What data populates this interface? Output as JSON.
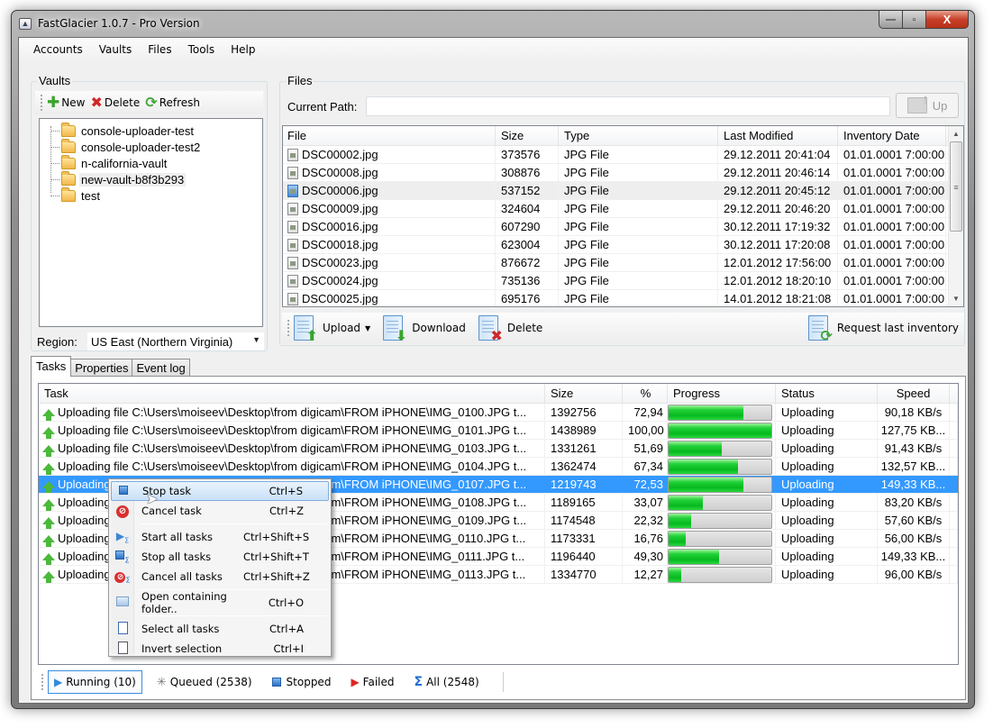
{
  "window": {
    "title": "FastGlacier 1.0.7 - Pro Version",
    "minimize_label": "—",
    "maximize_label": "▫",
    "close_label": "X"
  },
  "menu": [
    "Accounts",
    "Vaults",
    "Files",
    "Tools",
    "Help"
  ],
  "vaults": {
    "group_label": "Vaults",
    "toolbar": {
      "new": "New",
      "delete": "Delete",
      "refresh": "Refresh"
    },
    "items": [
      {
        "name": "console-uploader-test"
      },
      {
        "name": "console-uploader-test2"
      },
      {
        "name": "n-california-vault"
      },
      {
        "name": "new-vault-b8f3b293"
      },
      {
        "name": "test"
      }
    ],
    "region_label": "Region:",
    "region_value": "US East (Northern Virginia)"
  },
  "files": {
    "group_label": "Files",
    "current_path_label": "Current Path:",
    "current_path_value": "",
    "up_label": "Up",
    "columns": [
      "File",
      "Size",
      "Type",
      "Last Modified",
      "Inventory Date"
    ],
    "rows": [
      [
        "DSC00002.jpg",
        "373576",
        "JPG File",
        "29.12.2011 20:41:04",
        "01.01.0001 7:00:00"
      ],
      [
        "DSC00008.jpg",
        "308876",
        "JPG File",
        "29.12.2011 20:46:14",
        "01.01.0001 7:00:00"
      ],
      [
        "DSC00006.jpg",
        "537152",
        "JPG File",
        "29.12.2011 20:45:12",
        "01.01.0001 7:00:00"
      ],
      [
        "DSC00009.jpg",
        "324604",
        "JPG File",
        "29.12.2011 20:46:20",
        "01.01.0001 7:00:00"
      ],
      [
        "DSC00016.jpg",
        "607290",
        "JPG File",
        "30.12.2011 17:19:32",
        "01.01.0001 7:00:00"
      ],
      [
        "DSC00018.jpg",
        "623004",
        "JPG File",
        "30.12.2011 17:20:08",
        "01.01.0001 7:00:00"
      ],
      [
        "DSC00023.jpg",
        "876672",
        "JPG File",
        "12.01.2012 17:56:00",
        "01.01.0001 7:00:00"
      ],
      [
        "DSC00024.jpg",
        "735136",
        "JPG File",
        "12.01.2012 18:20:10",
        "01.01.0001 7:00:00"
      ],
      [
        "DSC00025.jpg",
        "695176",
        "JPG File",
        "14.01.2012 18:21:08",
        "01.01.0001 7:00:00"
      ]
    ],
    "toolbar": {
      "upload": "Upload",
      "download": "Download",
      "delete": "Delete",
      "request_inventory": "Request last inventory"
    }
  },
  "tabs": [
    "Tasks",
    "Properties",
    "Event log"
  ],
  "tasks": {
    "columns": [
      "Task",
      "Size",
      "%",
      "Progress",
      "Status",
      "Speed"
    ],
    "rows": [
      {
        "task": "Uploading file C:\\Users\\moiseev\\Desktop\\from digicam\\FROM iPHONE\\IMG_0100.JPG t...",
        "size": "1392756",
        "pct": "72,94",
        "progress": 72.94,
        "status": "Uploading",
        "speed": "90,18 KB/s"
      },
      {
        "task": "Uploading file C:\\Users\\moiseev\\Desktop\\from digicam\\FROM iPHONE\\IMG_0101.JPG t...",
        "size": "1438989",
        "pct": "100,00",
        "progress": 100,
        "status": "Uploading",
        "speed": "127,75 KB..."
      },
      {
        "task": "Uploading file C:\\Users\\moiseev\\Desktop\\from digicam\\FROM iPHONE\\IMG_0103.JPG t...",
        "size": "1331261",
        "pct": "51,69",
        "progress": 51.69,
        "status": "Uploading",
        "speed": "91,43 KB/s"
      },
      {
        "task": "Uploading file C:\\Users\\moiseev\\Desktop\\from digicam\\FROM iPHONE\\IMG_0104.JPG t...",
        "size": "1362474",
        "pct": "67,34",
        "progress": 67.34,
        "status": "Uploading",
        "speed": "132,57 KB..."
      },
      {
        "task": "Uploading file C:\\Users\\moiseev\\Desktop\\from digicam\\FROM iPHONE\\IMG_0107.JPG t...",
        "size": "1219743",
        "pct": "72,53",
        "progress": 72.53,
        "status": "Uploading",
        "speed": "149,33 KB..."
      },
      {
        "task": "Uploading file C:\\Users\\moiseev\\Desktop\\from digicam\\FROM iPHONE\\IMG_0108.JPG t...",
        "size": "1189165",
        "pct": "33,07",
        "progress": 33.07,
        "status": "Uploading",
        "speed": "83,20 KB/s"
      },
      {
        "task": "Uploading file C:\\Users\\moiseev\\Desktop\\from digicam\\FROM iPHONE\\IMG_0109.JPG t...",
        "size": "1174548",
        "pct": "22,32",
        "progress": 22.32,
        "status": "Uploading",
        "speed": "57,60 KB/s"
      },
      {
        "task": "Uploading file C:\\Users\\moiseev\\Desktop\\from digicam\\FROM iPHONE\\IMG_0110.JPG t...",
        "size": "1173331",
        "pct": "16,76",
        "progress": 16.76,
        "status": "Uploading",
        "speed": "56,00 KB/s"
      },
      {
        "task": "Uploading file C:\\Users\\moiseev\\Desktop\\from digicam\\FROM iPHONE\\IMG_0111.JPG t...",
        "size": "1196440",
        "pct": "49,30",
        "progress": 49.3,
        "status": "Uploading",
        "speed": "149,33 KB..."
      },
      {
        "task": "Uploading file C:\\Users\\moiseev\\Desktop\\from digicam\\FROM iPHONE\\IMG_0113.JPG t...",
        "size": "1334770",
        "pct": "12,27",
        "progress": 12.27,
        "status": "Uploading",
        "speed": "96,00 KB/s"
      }
    ],
    "selected_index": 4
  },
  "context_menu": {
    "items": [
      {
        "label": "Stop task",
        "shortcut": "Ctrl+S",
        "icon": "stop-icon"
      },
      {
        "label": "Cancel task",
        "shortcut": "Ctrl+Z",
        "icon": "cancel-icon"
      },
      {
        "label": "Start all tasks",
        "shortcut": "Ctrl+Shift+S",
        "icon": "start-all-icon"
      },
      {
        "label": "Stop all tasks",
        "shortcut": "Ctrl+Shift+T",
        "icon": "stop-all-icon"
      },
      {
        "label": "Cancel all tasks",
        "shortcut": "Ctrl+Shift+Z",
        "icon": "cancel-all-icon"
      },
      {
        "label": "Open containing folder..",
        "shortcut": "Ctrl+O",
        "icon": "folder-icon"
      },
      {
        "label": "Select all tasks",
        "shortcut": "Ctrl+A",
        "icon": "select-all-icon"
      },
      {
        "label": "Invert selection",
        "shortcut": "Ctrl+I",
        "icon": "invert-selection-icon"
      }
    ]
  },
  "status_filters": [
    {
      "label": "Running (10)",
      "icon": "running-icon"
    },
    {
      "label": "Queued (2538)",
      "icon": "queued-icon"
    },
    {
      "label": "Stopped",
      "icon": "stopped-icon"
    },
    {
      "label": "Failed",
      "icon": "failed-icon"
    },
    {
      "label": "All (2548)",
      "icon": "all-icon"
    }
  ],
  "colors": {
    "selection": "#3399ff",
    "progress_green": "#06b81e",
    "close_red": "#c8402a"
  }
}
